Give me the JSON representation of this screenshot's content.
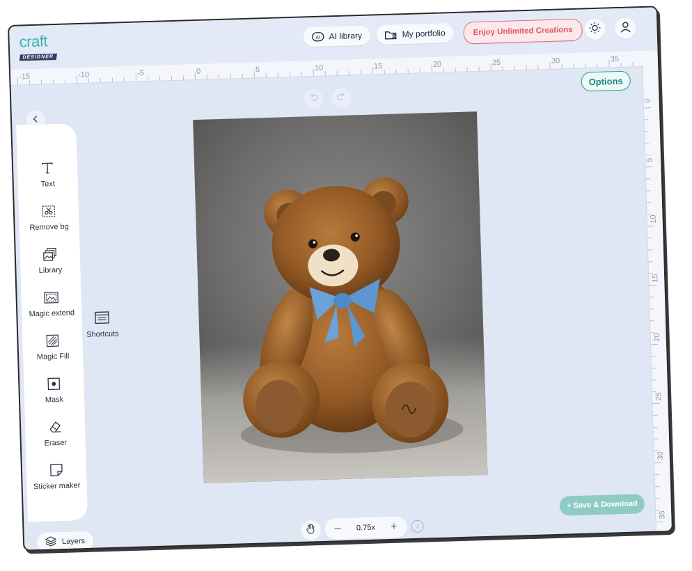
{
  "header": {
    "logo_top": "craft",
    "logo_bottom": "DESIGNER",
    "ai_library": "AI library",
    "ai_badge": "AI",
    "portfolio": "My portfolio",
    "unlimited": "Enjoy Unlimited Creations"
  },
  "ruler": {
    "h_labels": [
      "-15",
      "-10",
      "-5",
      "0",
      "5",
      "10",
      "15",
      "20",
      "25",
      "30",
      "35"
    ],
    "v_labels": [
      "0",
      "5",
      "10",
      "15",
      "20",
      "25",
      "30",
      "35"
    ]
  },
  "options_label": "Options",
  "tools": [
    {
      "label": "Text",
      "icon": "text-icon"
    },
    {
      "label": "Remove bg",
      "icon": "remove-bg-icon"
    },
    {
      "label": "Library",
      "icon": "library-icon"
    },
    {
      "label": "Magic extend",
      "icon": "magic-extend-icon"
    },
    {
      "label": "Magic Fill",
      "icon": "magic-fill-icon"
    },
    {
      "label": "Mask",
      "icon": "mask-icon"
    },
    {
      "label": "Eraser",
      "icon": "eraser-icon"
    },
    {
      "label": "Sticker maker",
      "icon": "sticker-icon"
    }
  ],
  "shortcuts_label": "Shortcuts",
  "layers_label": "Layers",
  "zoom": {
    "value": "0.75x",
    "minus": "–",
    "plus": "+"
  },
  "info_glyph": "i",
  "save_label": "+ Save & Download",
  "colors": {
    "accent": "#1d9a8c",
    "cta": "#e56b79",
    "background": "#dfe6f4",
    "save": "#8fcbc5"
  }
}
